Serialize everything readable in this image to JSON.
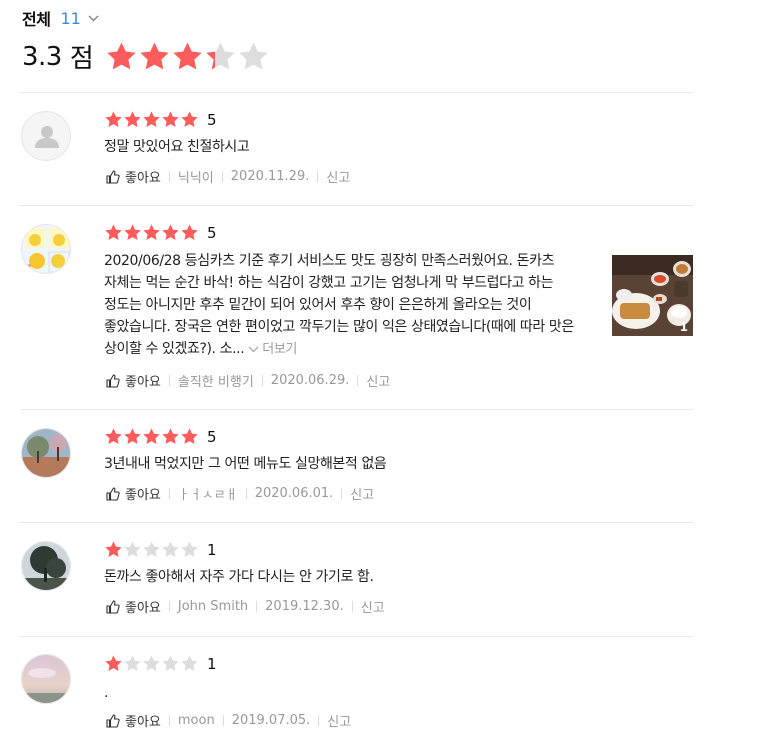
{
  "header": {
    "title": "전체",
    "count": "11"
  },
  "summary": {
    "score": "3.3",
    "unit": "점",
    "rating": 3.3,
    "max": 5
  },
  "colors": {
    "star_on": "#fc5c5c",
    "star_off": "#dddddd",
    "count_blue": "#3a8be6"
  },
  "reviews": [
    {
      "rating": 5,
      "score_label": "5",
      "text": "정말 맛있어요 친절하시고",
      "like_label": "좋아요",
      "author": "닉닉이",
      "date": "2020.11.29.",
      "report_label": "신고",
      "avatar": "default-avatar"
    },
    {
      "rating": 5,
      "score_label": "5",
      "text": "2020/06/28 등심카츠 기준 후기  서비스도 맛도 굉장히 만족스러웠어요.   돈카츠 자체는 먹는 순간 바삭! 하는 식감이 강했고 고기는 엄청나게 막 부드럽다고 하는 정도는 아니지만 후추 밑간이 되어 있어서 후추 향이 은은하게 올라오는 것이 좋았습니다.   장국은 연한 편이었고 깍두기는 많이 익은 상태였습니다(때에 따라 맛은 상이할 수 있겠죠?).  소...",
      "more_label": "더보기",
      "like_label": "좋아요",
      "author": "솔직한 비행기",
      "date": "2020.06.29.",
      "report_label": "신고",
      "photo_count": "1"
    },
    {
      "rating": 5,
      "score_label": "5",
      "text": "3년내내 먹었지만 그 어떤 메뉴도 실망해본적 없음",
      "like_label": "좋아요",
      "author": "ㅏㅓㅅㄹㅐ",
      "date": "2020.06.01.",
      "report_label": "신고"
    },
    {
      "rating": 1,
      "score_label": "1",
      "text": "돈까스 좋아해서 자주 가다 다시는 안 가기로 함.",
      "like_label": "좋아요",
      "author": "John Smith",
      "date": "2019.12.30.",
      "report_label": "신고"
    },
    {
      "rating": 1,
      "score_label": "1",
      "text": ".",
      "like_label": "좋아요",
      "author": "moon",
      "date": "2019.07.05.",
      "report_label": "신고"
    }
  ]
}
